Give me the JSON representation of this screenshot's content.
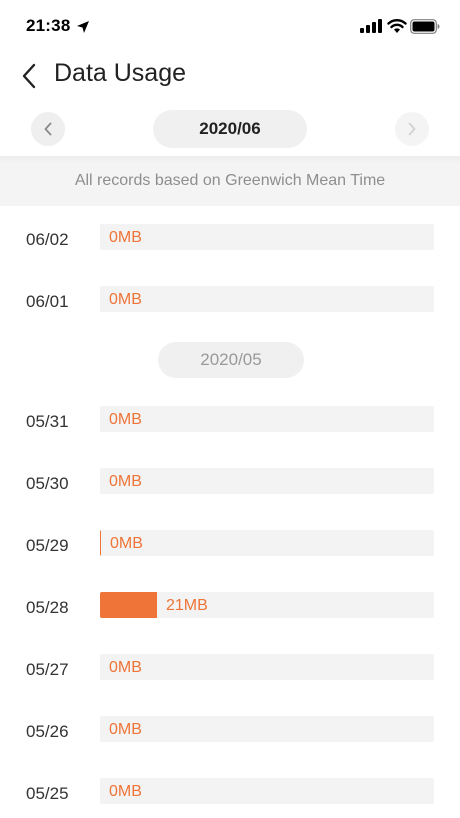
{
  "status_bar": {
    "time": "21:38",
    "icons": [
      "location-arrow-icon",
      "signal-icon",
      "wifi-icon",
      "battery-icon"
    ]
  },
  "header": {
    "title": "Data Usage",
    "back_icon": "chevron-left-icon"
  },
  "month_selector": {
    "current": "2020/06",
    "prev_icon": "chevron-left-icon",
    "next_icon": "chevron-right-icon"
  },
  "notice": "All records based on Greenwich Mean Time",
  "colors": {
    "accent": "#ee7437",
    "bar_background": "#f3f3f3",
    "pill_background": "#f0f0f0",
    "muted_text": "#8e8e8e"
  },
  "groups": [
    {
      "rows": [
        {
          "date": "06/02",
          "value": "0MB",
          "usage_mb": 0
        },
        {
          "date": "06/01",
          "value": "0MB",
          "usage_mb": 0
        }
      ]
    },
    {
      "label": "2020/05",
      "rows": [
        {
          "date": "05/31",
          "value": "0MB",
          "usage_mb": 0
        },
        {
          "date": "05/30",
          "value": "0MB",
          "usage_mb": 0
        },
        {
          "date": "05/29",
          "value": "0MB",
          "usage_mb": 0.1
        },
        {
          "date": "05/28",
          "value": "21MB",
          "usage_mb": 21
        },
        {
          "date": "05/27",
          "value": "0MB",
          "usage_mb": 0
        },
        {
          "date": "05/26",
          "value": "0MB",
          "usage_mb": 0
        },
        {
          "date": "05/25",
          "value": "0MB",
          "usage_mb": 0
        }
      ]
    }
  ],
  "max_usage_mb": 124
}
